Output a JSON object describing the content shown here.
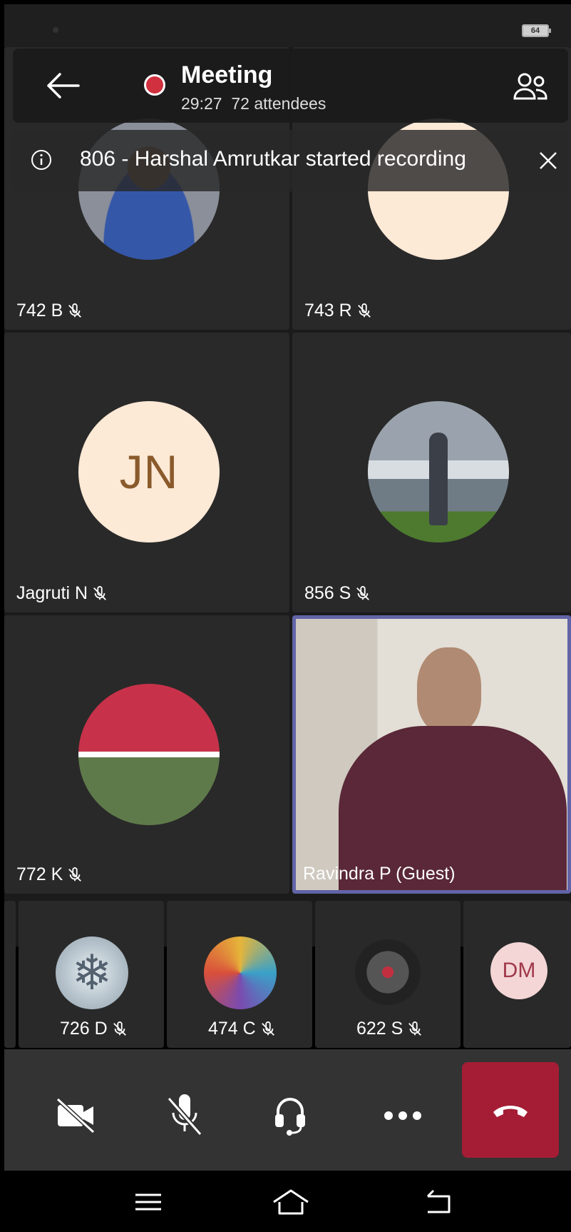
{
  "status_bar": {
    "battery": "64"
  },
  "header": {
    "title": "Meeting",
    "elapsed": "29:27",
    "attendees": "72 attendees"
  },
  "banner": {
    "message": "806 - Harshal Amrutkar started recording"
  },
  "grid": [
    {
      "name": "742 B",
      "avatar": "photo"
    },
    {
      "name": "743 R",
      "avatar": "digit-7-avatar"
    },
    {
      "name": "Jagruti N",
      "initials": "JN"
    },
    {
      "name": "856 S",
      "avatar": "photo-sea"
    },
    {
      "name": "772 K",
      "avatar": "photo-collage"
    },
    {
      "name": "Ravindra P (Guest)",
      "avatar": "video"
    }
  ],
  "strip": [
    {
      "name": "726 D",
      "avatar": "snowflake"
    },
    {
      "name": "474 C",
      "avatar": "art"
    },
    {
      "name": "622 S",
      "avatar": "dark-photo"
    },
    {
      "initials": "DM"
    }
  ],
  "colors": {
    "hangup": "#a51d35",
    "recording": "#d1303f",
    "active_speaker": "#6264a7"
  },
  "controls": [
    "camera-off-icon",
    "mic-off-icon",
    "headset-icon",
    "more-icon",
    "hangup-icon"
  ]
}
